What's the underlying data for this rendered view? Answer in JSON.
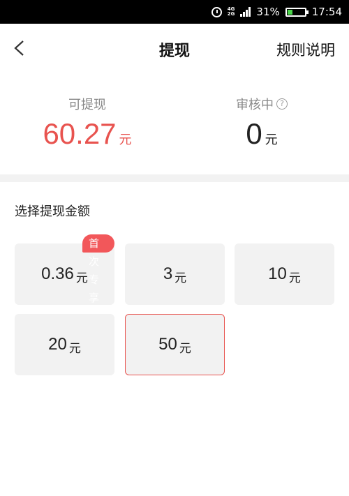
{
  "status_bar": {
    "network_top": "4G",
    "network_bottom": "2G",
    "battery": "31%",
    "battery_level": 0.31,
    "time": "17:54",
    "battery_color": "#4bd64b"
  },
  "nav": {
    "title": "提现",
    "rules": "规则说明",
    "back_icon": "chevron-left-icon"
  },
  "summary": {
    "available_label": "可提现",
    "available_amount": "60.27",
    "available_unit": "元",
    "review_label": "审核中",
    "review_amount": "0",
    "review_unit": "元",
    "help_glyph": "?"
  },
  "section": {
    "title": "选择提现金额"
  },
  "amounts": [
    {
      "value": "0.36",
      "unit": "元",
      "badge": "首次专享",
      "selected": false
    },
    {
      "value": "3",
      "unit": "元",
      "selected": false
    },
    {
      "value": "10",
      "unit": "元",
      "selected": false
    },
    {
      "value": "20",
      "unit": "元",
      "selected": false
    },
    {
      "value": "50",
      "unit": "元",
      "selected": true
    }
  ],
  "colors": {
    "accent_red": "#e8534f",
    "card_bg": "#f2f2f2"
  }
}
